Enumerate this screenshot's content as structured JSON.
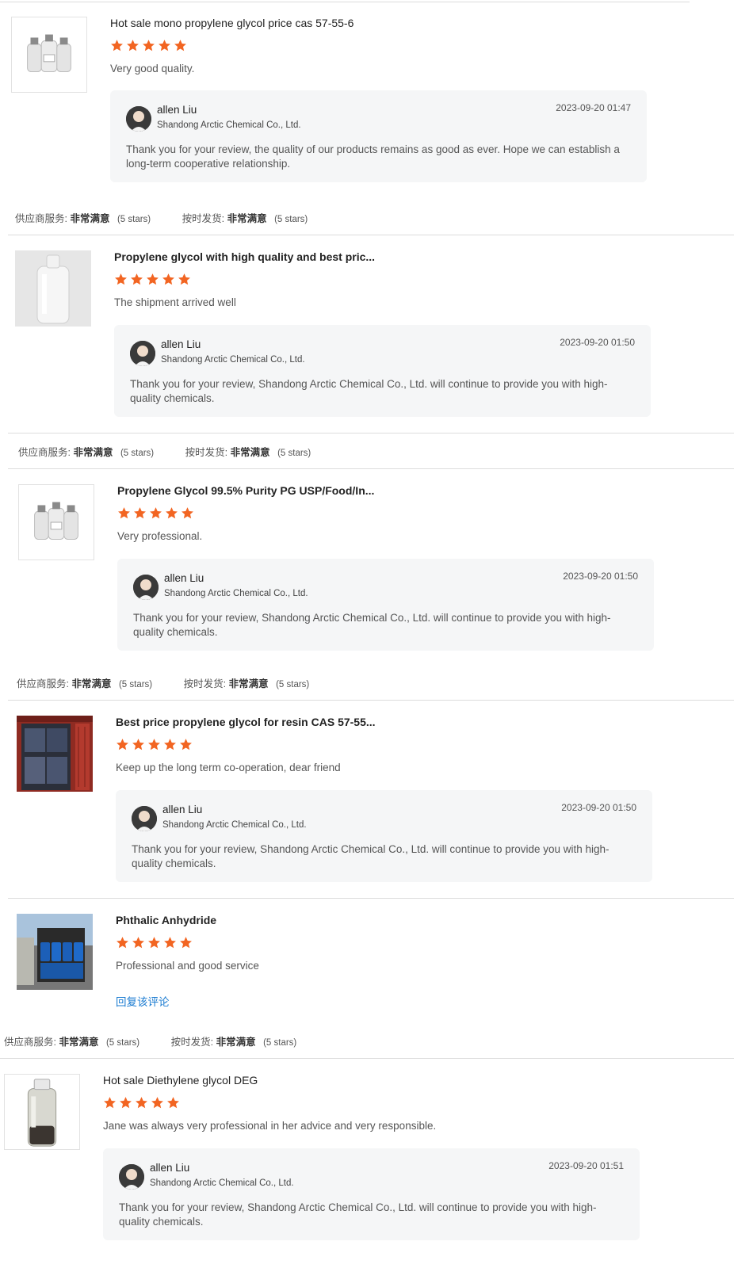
{
  "reviews": [
    {
      "product_title": "Hot sale mono propylene glycol price cas 57-55-6",
      "rating": 5,
      "comment": "Very good quality.",
      "image_icon": "bottles-icon",
      "reply": {
        "name": "allen Liu",
        "company": "Shandong Arctic Chemical Co., Ltd.",
        "date": "2023-09-20 01:47",
        "message": "Thank you for your review, the quality of our products remains as good as ever. Hope we can establish a long-term cooperative relationship."
      },
      "ratings": {
        "supplier_label": "供应商服务:",
        "supplier_value": "非常满意",
        "supplier_count": "(5 stars)",
        "delivery_label": "按时发货:",
        "delivery_value": "非常满意",
        "delivery_count": "(5 stars)"
      }
    },
    {
      "product_title": "Propylene glycol with high quality and best pric...",
      "rating": 5,
      "comment": "The shipment arrived well",
      "image_icon": "clear-bottle-icon",
      "reply": {
        "name": "allen Liu",
        "company": "Shandong Arctic Chemical Co., Ltd.",
        "date": "2023-09-20 01:50",
        "message": "Thank you for your review, Shandong Arctic Chemical Co., Ltd. will continue to provide you with high-quality chemicals."
      },
      "ratings": {
        "supplier_label": "供应商服务:",
        "supplier_value": "非常满意",
        "supplier_count": "(5 stars)",
        "delivery_label": "按时发货:",
        "delivery_value": "非常满意",
        "delivery_count": "(5 stars)"
      }
    },
    {
      "product_title": "Propylene Glycol 99.5% Purity PG USP/Food/In...",
      "rating": 5,
      "comment": "Very professional.",
      "image_icon": "bottles-icon",
      "reply": {
        "name": "allen Liu",
        "company": "Shandong Arctic Chemical Co., Ltd.",
        "date": "2023-09-20 01:50",
        "message": "Thank you for your review, Shandong Arctic Chemical Co., Ltd. will continue to provide you with high-quality chemicals."
      },
      "ratings": {
        "supplier_label": "供应商服务:",
        "supplier_value": "非常满意",
        "supplier_count": "(5 stars)",
        "delivery_label": "按时发货:",
        "delivery_value": "非常满意",
        "delivery_count": "(5 stars)"
      }
    },
    {
      "product_title": "Best price propylene glycol for resin CAS 57-55...",
      "rating": 5,
      "comment": "Keep up the long term co-operation, dear friend",
      "image_icon": "container-icon",
      "reply": {
        "name": "allen Liu",
        "company": "Shandong Arctic Chemical Co., Ltd.",
        "date": "2023-09-20 01:50",
        "message": "Thank you for your review, Shandong Arctic Chemical Co., Ltd. will continue to provide you with high-quality chemicals."
      }
    },
    {
      "product_title": "Phthalic Anhydride",
      "rating": 5,
      "comment": "Professional and good service",
      "image_icon": "blue-drums-icon",
      "reply_link": "回复该评论",
      "ratings": {
        "supplier_label": "供应商服务:",
        "supplier_value": "非常满意",
        "supplier_count": "(5 stars)",
        "delivery_label": "按时发货:",
        "delivery_value": "非常满意",
        "delivery_count": "(5 stars)"
      }
    },
    {
      "product_title": "Hot sale Diethylene glycol DEG",
      "rating": 5,
      "comment": "Jane was always very professional in her advice and very responsible.",
      "image_icon": "bottle-icon",
      "reply": {
        "name": "allen Liu",
        "company": "Shandong Arctic Chemical Co., Ltd.",
        "date": "2023-09-20 01:51",
        "message": "Thank you for your review, Shandong Arctic Chemical Co., Ltd. will continue to provide you with high-quality chemicals."
      }
    }
  ],
  "colors": {
    "star": "#f26522",
    "link": "#1a7bd1",
    "reply_bg": "#f5f6f7",
    "divider": "#dcdcdc"
  }
}
